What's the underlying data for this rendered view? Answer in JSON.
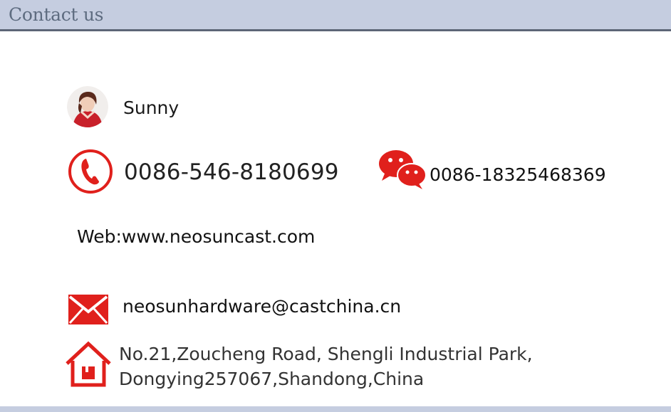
{
  "header": {
    "title": "Contact us"
  },
  "contact": {
    "name": "Sunny",
    "phone": "0086-546-8180699",
    "wechat": "0086-18325468369",
    "web": "Web:www.neosuncast.com",
    "email": "neosunhardware@castchina.cn",
    "address_line1": "No.21,Zoucheng Road, Shengli Industrial Park,",
    "address_line2": "Dongying257067,Shandong,China"
  },
  "icons": {
    "avatar": "person-avatar",
    "phone": "phone-icon",
    "wechat": "wechat-icon",
    "email": "mail-icon",
    "address": "house-icon"
  },
  "colors": {
    "header_bg": "#c5cde0",
    "header_border": "#5d6677",
    "header_text": "#5e6c80",
    "icon_red": "#e0201c"
  }
}
